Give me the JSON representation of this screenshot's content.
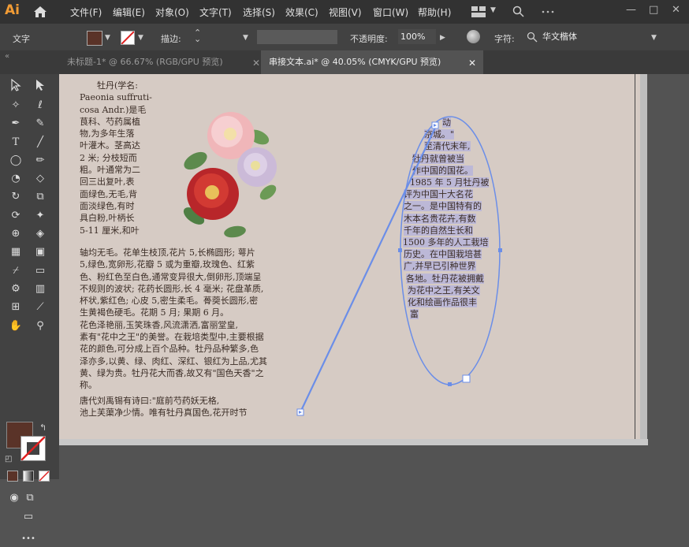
{
  "app": {
    "logo": "Ai"
  },
  "menu": [
    "文件(F)",
    "编辑(E)",
    "对象(O)",
    "文字(T)",
    "选择(S)",
    "效果(C)",
    "视图(V)",
    "窗口(W)",
    "帮助(H)"
  ],
  "window_controls": [
    "—",
    "□",
    "✕"
  ],
  "control_bar": {
    "object_type": "文字",
    "stroke_label": "描边:",
    "opacity_label": "不透明度:",
    "opacity_value": "100%",
    "char_label": "字符:",
    "font_value": "华文楷体",
    "fill_color": "#5a3328"
  },
  "tabs": [
    {
      "label": "未标题-1* @ 66.67% (RGB/GPU 预览)",
      "close": "✕"
    },
    {
      "label": "串接文本.ai* @ 40.05% (CMYK/GPU 预览)",
      "close": "✕"
    }
  ],
  "left_text": [
    "牡丹(学名:",
    "Paeonia suffruti-",
    "cosa Andr.)是毛",
    "茛科、芍药属植",
    "物,为多年生落",
    "叶灌木。茎高达",
    "2 米; 分枝短而",
    "粗。叶通常为二",
    "回三出复叶,表",
    "面绿色,无毛,背",
    "面淡绿色,有时",
    "具白粉,叶柄长",
    "5-11 厘米,和叶"
  ],
  "body_text": [
    "轴均无毛。花单生枝顶,花片 5,长椭圆形; 萼片",
    "5,绿色,宽卵形,花瓣 5 或为重瓣,玫瑰色、红紫",
    "色、粉红色至白色,通常变异很大,倒卵形,顶端呈",
    "不规则的波状; 花药长圆形,长 4 毫米; 花盘革质,",
    "杯状,紫红色; 心皮 5,密生柔毛。蓇葖长圆形,密",
    "生黄褐色硬毛。花期 5 月; 果期 6 月。",
    "    花色泽艳丽,玉笑珠香,风流潇洒,富丽堂皇,",
    "素有\"花中之王\"的美誉。在栽培类型中,主要根据",
    "花的颜色,可分成上百个品种。牡丹品种繁多,色",
    "泽亦多,以黄、绿、肉红、深红、银红为上品,尤其",
    "黄、绿为贵。牡丹花大而香,故又有\"国色天香\"之",
    "称。",
    "    唐代刘禹锡有诗曰:\"庭前芍药妖无格,",
    "    池上芙蕖净少情。唯有牡丹真国色,花开时节"
  ],
  "ellipse_text": [
    "动",
    "京城。\"",
    "至清代末年,",
    "牡丹就曾被当",
    "作中国的国花。",
    "1985 年 5 月牡丹被",
    "评为中国十大名花",
    "之一。是中国特有的",
    "木本名贵花卉,有数",
    "千年的自然生长和",
    "1500 多年的人工栽培",
    "历史。在中国栽培甚",
    "广,并早已引种世界",
    "各地。牡丹花被拥戴",
    "为花中之王,有关文",
    "化和绘画作品很丰",
    "富"
  ]
}
